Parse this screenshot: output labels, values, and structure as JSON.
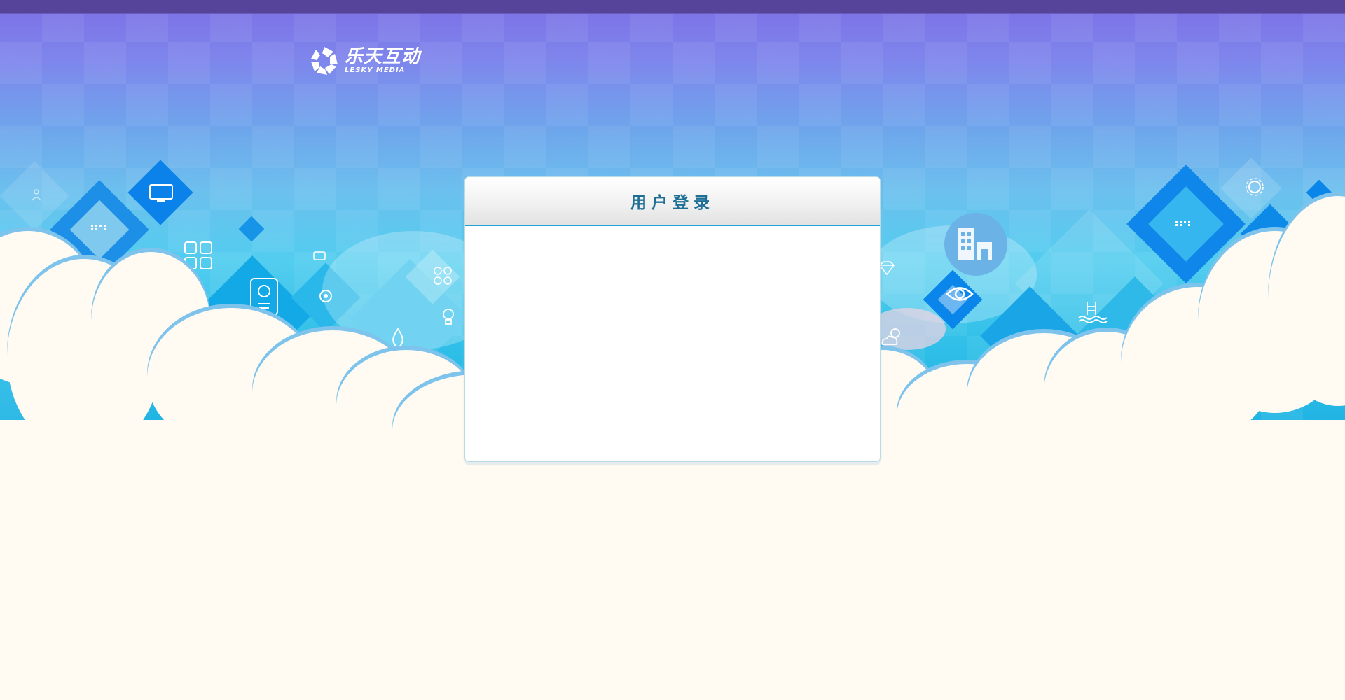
{
  "brand": {
    "name_cn": "乐天互动",
    "name_en": "LESKY MEDIA",
    "logo_icon": "aperture-logo-icon"
  },
  "login": {
    "title": "用户登录"
  },
  "decor_icons": [
    "monitor-icon",
    "grid-icon",
    "chat-icon",
    "phone-icon",
    "refresh-icon",
    "drop-icon",
    "bulb-icon",
    "leaf-icon",
    "apps-icon",
    "building-icon",
    "eye-icon",
    "pool-icon",
    "settings-icon",
    "weather-icon",
    "diamond-gem-icon",
    "wifi-dots-icon"
  ],
  "colors": {
    "top_bar": "#56449a",
    "sky_top": "#7c6fe6",
    "sky_bottom": "#1fb3e2",
    "cloud": "#fffbf2",
    "title": "#1e6f95",
    "accent_line": "#1fa4d4"
  }
}
